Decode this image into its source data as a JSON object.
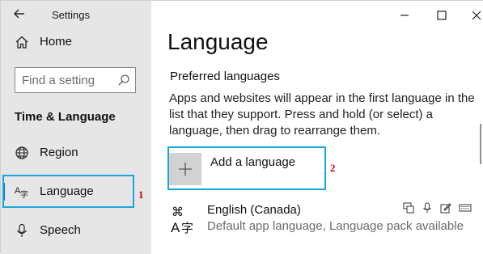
{
  "window": {
    "app_title": "Settings"
  },
  "sidebar": {
    "home_label": "Home",
    "search": {
      "placeholder": "Find a setting"
    },
    "section_title": "Time & Language",
    "items": [
      {
        "label": "Region",
        "icon": "globe-icon"
      },
      {
        "label": "Language",
        "icon": "language-icon",
        "selected": true
      },
      {
        "label": "Speech",
        "icon": "microphone-icon"
      }
    ]
  },
  "main": {
    "title": "Language",
    "subheading": "Preferred languages",
    "description": "Apps and websites will appear in the first language in the list that they support. Press and hold (or select) a language, then drag to rearrange them.",
    "add_language_label": "Add a language",
    "languages": [
      {
        "name": "English (Canada)",
        "details": "Default app language, Language pack available",
        "features": [
          "display-language-icon",
          "speech-icon",
          "handwriting-icon",
          "keyboard-icon"
        ]
      }
    ]
  },
  "annotations": {
    "marker_1": "1",
    "marker_2": "2",
    "color": "#d0021b",
    "box_color": "#1aa7e0"
  },
  "colors": {
    "sidebar_bg": "#e6e6e6",
    "accent": "#0078d7"
  }
}
